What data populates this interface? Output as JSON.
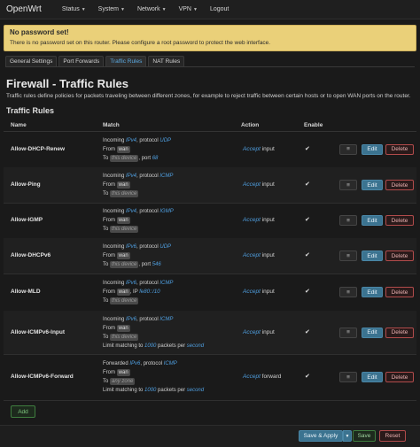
{
  "brand": "OpenWrt",
  "menu": [
    "Status",
    "System",
    "Network",
    "VPN",
    "Logout"
  ],
  "alert": {
    "title": "No password set!",
    "message": "There is no password set on this router. Please configure a root password to protect the web interface."
  },
  "tabs": [
    "General Settings",
    "Port Forwards",
    "Traffic Rules",
    "NAT Rules"
  ],
  "page": {
    "title": "Firewall - Traffic Rules",
    "description": "Traffic rules define policies for packets traveling between different zones, for example to reject traffic between certain hosts or to open WAN ports on the router.",
    "section": "Traffic Rules"
  },
  "table": {
    "headers": [
      "Name",
      "Match",
      "Action",
      "Enable"
    ],
    "rows": [
      {
        "name": "Allow-DHCP-Renew",
        "l1a": "Incoming ",
        "l1b": "IPv4",
        "l1c": ", protocol ",
        "l1d": "UDP",
        "from": "wan",
        "to": "this device",
        "extra_a": ", port ",
        "extra_b": "68",
        "action": "Accept",
        "action_suffix": " input"
      },
      {
        "name": "Allow-Ping",
        "l1a": "Incoming ",
        "l1b": "IPv4",
        "l1c": ", protocol ",
        "l1d": "ICMP",
        "from": "wan",
        "to": "this device",
        "action": "Accept",
        "action_suffix": " input"
      },
      {
        "name": "Allow-IGMP",
        "l1a": "Incoming ",
        "l1b": "IPv4",
        "l1c": ", protocol ",
        "l1d": "IGMP",
        "from": "wan",
        "to": "this device",
        "action": "Accept",
        "action_suffix": " input"
      },
      {
        "name": "Allow-DHCPv6",
        "l1a": "Incoming ",
        "l1b": "IPv6",
        "l1c": ", protocol ",
        "l1d": "UDP",
        "from": "wan",
        "to": "this device",
        "extra_a": ", port ",
        "extra_b": "546",
        "action": "Accept",
        "action_suffix": " input"
      },
      {
        "name": "Allow-MLD",
        "l1a": "Incoming ",
        "l1b": "IPv6",
        "l1c": ", protocol ",
        "l1d": "ICMP",
        "from": "wan",
        "from_extra_a": ", IP ",
        "from_extra_b": "fe80::/10",
        "to": "this device",
        "action": "Accept",
        "action_suffix": " input"
      },
      {
        "name": "Allow-ICMPv6-Input",
        "l1a": "Incoming ",
        "l1b": "IPv6",
        "l1c": ", protocol ",
        "l1d": "ICMP",
        "from": "wan",
        "to": "this device",
        "limit_a": "Limit matching to ",
        "limit_b": "1000",
        "limit_c": " packets per ",
        "limit_d": "second",
        "action": "Accept",
        "action_suffix": " input"
      },
      {
        "name": "Allow-ICMPv6-Forward",
        "l1a": "Forwarded ",
        "l1b": "IPv6",
        "l1c": ", protocol ",
        "l1d": "ICMP",
        "from": "wan",
        "to": "any zone",
        "limit_a": "Limit matching to ",
        "limit_b": "1000",
        "limit_c": " packets per ",
        "limit_d": "second",
        "action": "Accept",
        "action_suffix": " forward"
      }
    ],
    "from_label": "From ",
    "to_label": "To ",
    "checkbox_glyph": "✔",
    "edit_label": "Edit",
    "delete_label": "Delete",
    "drag_glyph": "≡"
  },
  "add_label": "Add",
  "footer": {
    "apply_label": "Save & Apply",
    "save_label": "Save",
    "reset_label": "Reset"
  }
}
